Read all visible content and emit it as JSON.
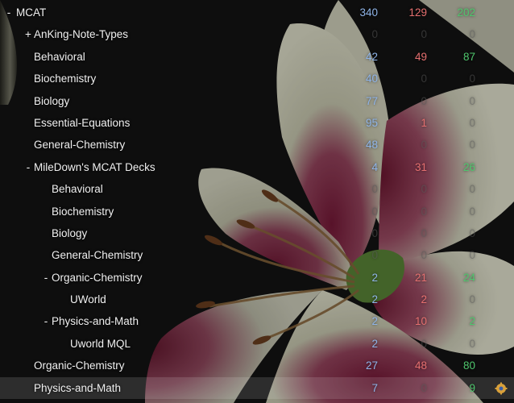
{
  "colors": {
    "new": "#8fb4e8",
    "learning": "#e56f6f",
    "review": "#4fc66d",
    "zero": "#555555",
    "background": "#141414",
    "selected_row": "#2c2c2c"
  },
  "decks": [
    {
      "toggle": "-",
      "name": "MCAT",
      "level": 0,
      "new": "340",
      "learn": "129",
      "review": "202"
    },
    {
      "toggle": "+",
      "name": "AnKing-Note-Types",
      "level": 1,
      "new": "0",
      "learn": "0",
      "review": "0"
    },
    {
      "toggle": "",
      "name": "Behavioral",
      "level": 1,
      "new": "42",
      "learn": "49",
      "review": "87"
    },
    {
      "toggle": "",
      "name": "Biochemistry",
      "level": 1,
      "new": "40",
      "learn": "0",
      "review": "0"
    },
    {
      "toggle": "",
      "name": "Biology",
      "level": 1,
      "new": "77",
      "learn": "0",
      "review": "0"
    },
    {
      "toggle": "",
      "name": "Essential-Equations",
      "level": 1,
      "new": "95",
      "learn": "1",
      "review": "0"
    },
    {
      "toggle": "",
      "name": "General-Chemistry",
      "level": 1,
      "new": "48",
      "learn": "0",
      "review": "0"
    },
    {
      "toggle": "-",
      "name": "MileDown's MCAT Decks",
      "level": 1,
      "new": "4",
      "learn": "31",
      "review": "26"
    },
    {
      "toggle": "",
      "name": "Behavioral",
      "level": 2,
      "new": "0",
      "learn": "0",
      "review": "0"
    },
    {
      "toggle": "",
      "name": "Biochemistry",
      "level": 2,
      "new": "0",
      "learn": "0",
      "review": "0"
    },
    {
      "toggle": "",
      "name": "Biology",
      "level": 2,
      "new": "0",
      "learn": "0",
      "review": "0"
    },
    {
      "toggle": "",
      "name": "General-Chemistry",
      "level": 2,
      "new": "0",
      "learn": "0",
      "review": "0"
    },
    {
      "toggle": "-",
      "name": "Organic-Chemistry",
      "level": 2,
      "new": "2",
      "learn": "21",
      "review": "24"
    },
    {
      "toggle": "",
      "name": "UWorld",
      "level": 3,
      "new": "2",
      "learn": "2",
      "review": "0"
    },
    {
      "toggle": "-",
      "name": "Physics-and-Math",
      "level": 2,
      "new": "2",
      "learn": "10",
      "review": "2"
    },
    {
      "toggle": "",
      "name": "Uworld MQL",
      "level": 3,
      "new": "2",
      "learn": "0",
      "review": "0"
    },
    {
      "toggle": "",
      "name": "Organic-Chemistry",
      "level": 1,
      "new": "27",
      "learn": "48",
      "review": "80"
    },
    {
      "toggle": "",
      "name": "Physics-and-Math",
      "level": 1,
      "new": "7",
      "learn": "0",
      "review": "9",
      "selected": true,
      "gear_icon": "gear-icon"
    }
  ]
}
